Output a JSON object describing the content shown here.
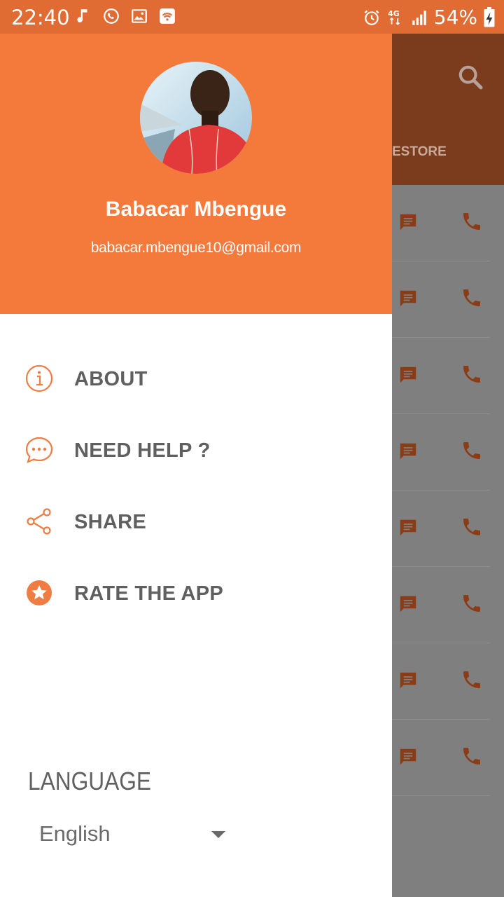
{
  "status_bar": {
    "time": "22:40",
    "battery": "54%",
    "network": "4G",
    "left_icons": [
      "music-note-icon",
      "whatsapp-icon",
      "image-icon",
      "wifi-hotspot-icon"
    ],
    "right_icons": [
      "alarm-icon",
      "network-4g-icon",
      "signal-icon",
      "battery-charging-icon"
    ]
  },
  "background": {
    "tab_fragment": "ESTORE",
    "row_icons": [
      "message-icon",
      "phone-icon"
    ],
    "colors": {
      "appbar": "#7b3c1e",
      "overlay": "#7f7f7f",
      "accent_dark": "#8b3c17"
    }
  },
  "drawer": {
    "user": {
      "name": "Babacar Mbengue",
      "email": "babacar.mbengue10@gmail.com"
    },
    "menu": [
      {
        "label": "ABOUT",
        "icon": "info-icon"
      },
      {
        "label": "NEED HELP ?",
        "icon": "chat-bubble-icon"
      },
      {
        "label": "SHARE",
        "icon": "share-icon"
      },
      {
        "label": "RATE THE APP",
        "icon": "star-icon"
      }
    ],
    "language": {
      "title": "LANGUAGE",
      "selected": "English"
    },
    "colors": {
      "header": "#f47a3c",
      "accent": "#ef7c42",
      "text": "#5f5f5f"
    }
  }
}
